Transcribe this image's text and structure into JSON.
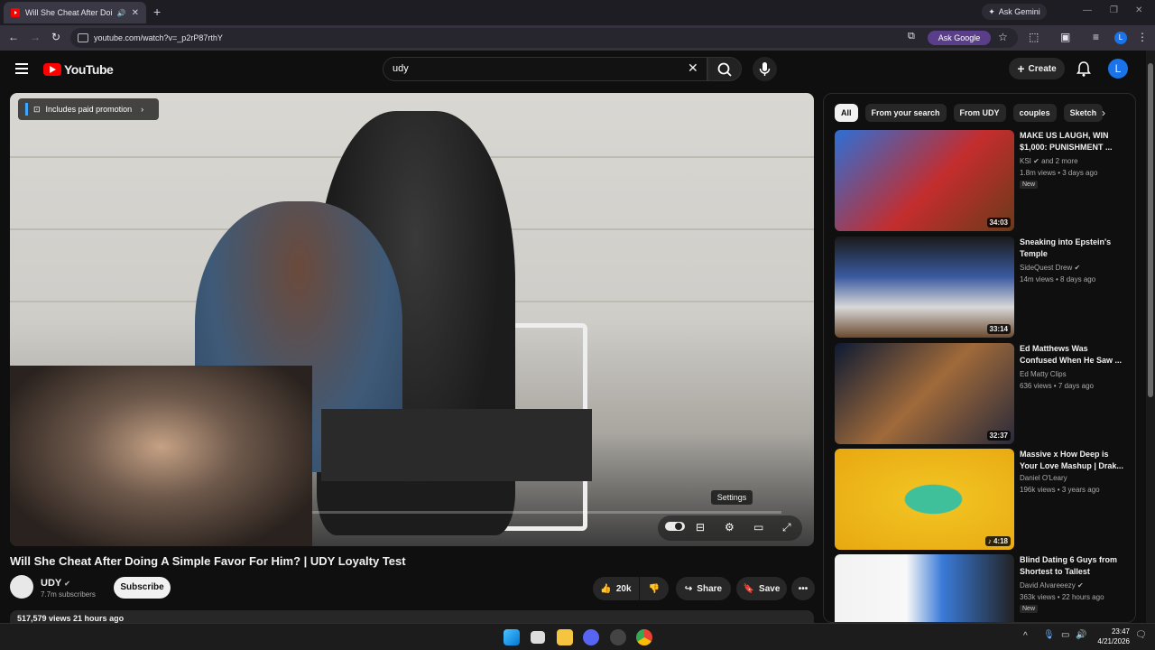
{
  "browser": {
    "tab_title": "Will She Cheat After Doing",
    "new_tab": "+",
    "ask_gemini": "Ask Gemini",
    "url": "youtube.com/watch?v=_p2rP87rthY",
    "ask_google": "Ask Google",
    "profile_initial": "L"
  },
  "youtube": {
    "logo_text": "YouTube",
    "search_value": "udy",
    "create_label": "Create",
    "avatar_initial": "L"
  },
  "player": {
    "promo_label": "Includes paid promotion",
    "settings_tooltip": "Settings",
    "accent_color": "#ff0000"
  },
  "video": {
    "title": "Will She Cheat After Doing A Simple Favor For Him? | UDY Loyalty Test",
    "channel": "UDY",
    "subscribers": "7.7m subscribers",
    "subscribe_label": "Subscribe",
    "likes": "20k",
    "share_label": "Share",
    "save_label": "Save",
    "views_line": "517,579 views  21 hours ago"
  },
  "sidebar": {
    "chips": [
      "All",
      "From your search",
      "From UDY",
      "couples",
      "Sketch"
    ],
    "recommendations": [
      {
        "title": "MAKE US LAUGH, WIN $1,000: PUNISHMENT ...",
        "channel": "KSI",
        "channel_extra": "and 2 more",
        "meta": "1.8m views • 3 days ago",
        "badge": "New",
        "duration": "34:03"
      },
      {
        "title": "Sneaking into Epstein's Temple",
        "channel": "SideQuest Drew",
        "meta": "14m views • 8 days ago",
        "duration": "33:14"
      },
      {
        "title": "Ed Matthews Was Confused When He Saw ...",
        "channel": "Ed Matty Clips",
        "meta": "636 views • 7 days ago",
        "duration": "32:37"
      },
      {
        "title": "Massive x How Deep is Your Love Mashup | Drak...",
        "channel": "Daniel O'Leary",
        "meta": "196k views • 3 years ago",
        "duration": "4:18"
      },
      {
        "title": "Blind Dating 6 Guys from Shortest to Tallest",
        "channel": "David Alvareeezy",
        "meta": "363k views • 22 hours ago",
        "badge": "New"
      }
    ]
  },
  "taskbar": {
    "time": "23:47",
    "date": "4/21/2026"
  }
}
